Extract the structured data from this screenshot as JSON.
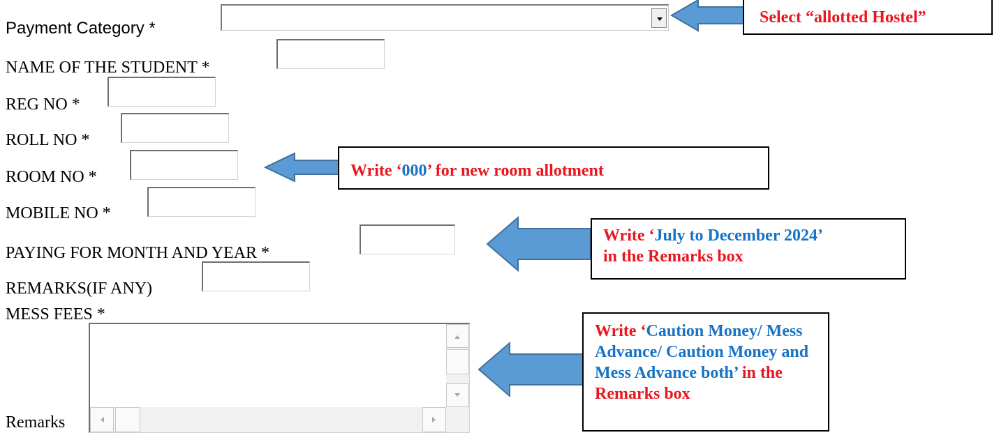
{
  "form": {
    "payment_category_label": "Payment Category *",
    "payment_category_value": "",
    "fields": [
      {
        "label": "NAME OF THE STUDENT *",
        "value": ""
      },
      {
        "label": "REG NO *",
        "value": ""
      },
      {
        "label": "ROLL NO *",
        "value": ""
      },
      {
        "label": "ROOM NO *",
        "value": ""
      },
      {
        "label": "MOBILE NO *",
        "value": ""
      },
      {
        "label": "PAYING FOR MONTH AND YEAR *",
        "value": ""
      },
      {
        "label": "REMARKS(IF ANY)",
        "value": ""
      }
    ],
    "mess_fees_label": "MESS FEES *",
    "remarks_label": "Remarks",
    "remarks_value": ""
  },
  "callouts": {
    "hostel": {
      "prefix": "Select “",
      "highlight": "allotted Hostel",
      "suffix": "”"
    },
    "room": {
      "prefix": "Write ‘",
      "highlight": "000",
      "suffix": "’ for new room allotment"
    },
    "month": {
      "prefix": "Write ‘",
      "highlight": "July to December 2024’",
      "line2": "in the Remarks box"
    },
    "mess": {
      "prefix": "Write ‘",
      "highlight": "Caution Money/ Mess Advance/ Caution Money and Mess Advance both’",
      "suffix": " in the Remarks box"
    }
  },
  "icons": [
    "dropdown-arrow-icon",
    "left-arrow-icon",
    "scroll-up-icon",
    "scroll-down-icon",
    "scroll-left-icon",
    "scroll-right-icon"
  ],
  "colors": {
    "annotation_red": "#e8161e",
    "annotation_blue": "#1773c5",
    "arrow_fill": "#5b9bd5",
    "arrow_stroke": "#41719c"
  }
}
